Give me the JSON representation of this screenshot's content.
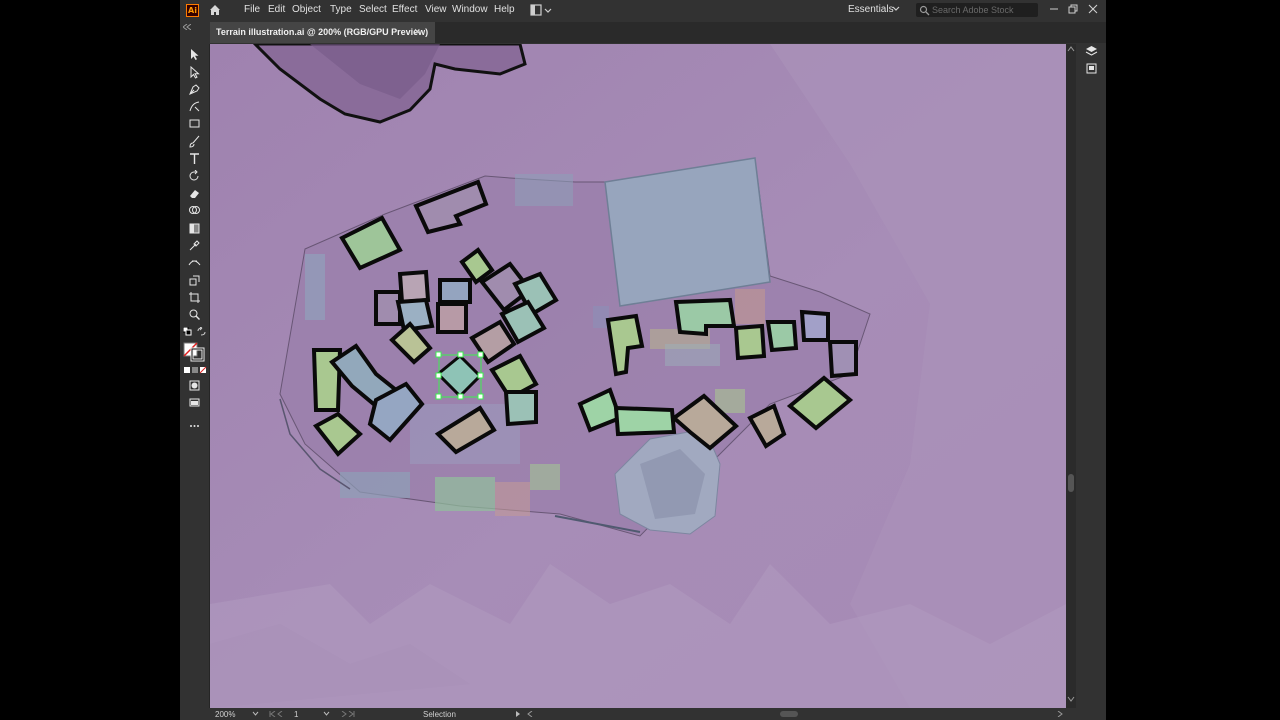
{
  "app": {
    "logo_text": "Ai",
    "accent": "#ff9a00"
  },
  "menu": [
    "File",
    "Edit",
    "Object",
    "Type",
    "Select",
    "Effect",
    "View",
    "Window",
    "Help"
  ],
  "workspace": {
    "label": "Essentials"
  },
  "search": {
    "placeholder": "Search Adobe Stock"
  },
  "tab": {
    "title": "Terrain illustration.ai @ 200% (RGB/GPU Preview)",
    "close": "×"
  },
  "tools": [
    "selection-tool",
    "direct-selection-tool",
    "pen-tool",
    "curvature-tool",
    "rectangle-tool",
    "paintbrush-tool",
    "type-tool",
    "rotate-tool",
    "eraser-tool",
    "shape-builder-tool",
    "gradient-tool",
    "eyedropper-tool",
    "width-tool",
    "scale-tool",
    "artboard-tool",
    "zoom-tool"
  ],
  "status": {
    "zoom": "200%",
    "artboard": "1",
    "tool": "Selection"
  },
  "colors": {
    "canvas": "#9a80ac",
    "ui": "#323232",
    "selection": "#3cf050"
  }
}
